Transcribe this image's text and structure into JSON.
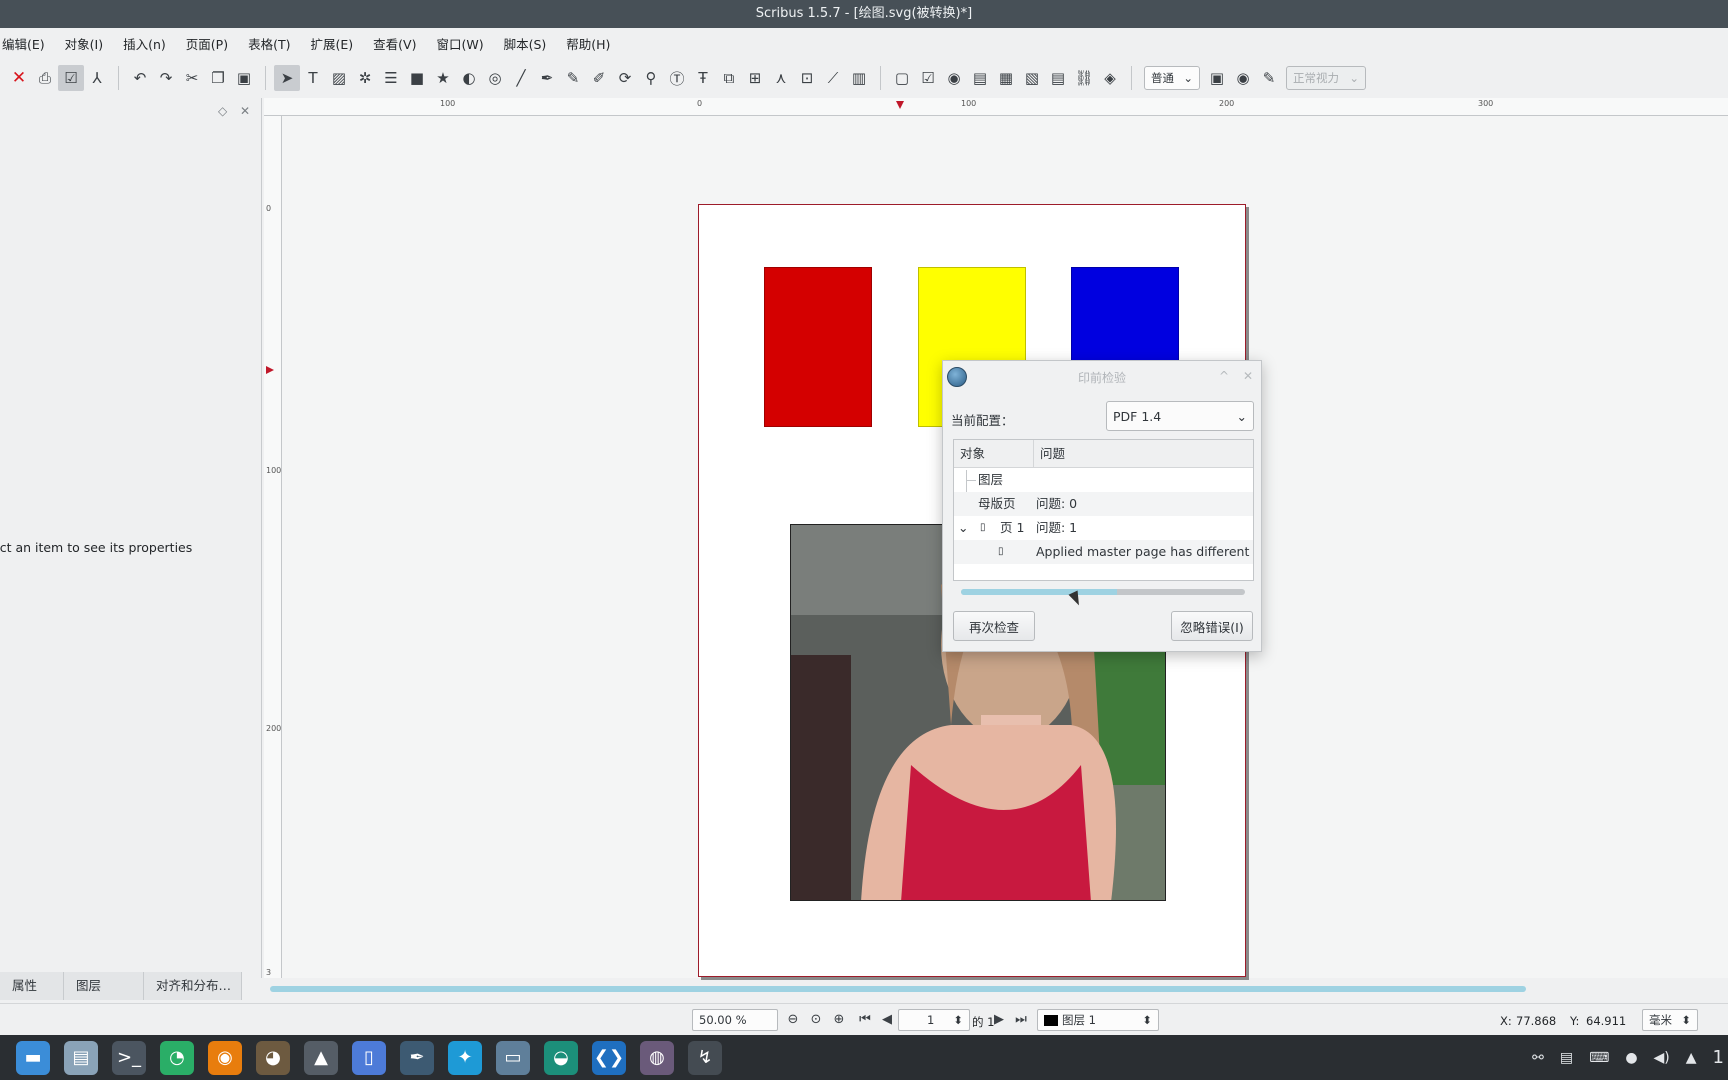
{
  "window": {
    "title": "Scribus 1.5.7 - [绘图.svg(被转换)*]"
  },
  "menu": [
    "编辑(E)",
    "对象(I)",
    "插入(n)",
    "页面(P)",
    "表格(T)",
    "扩展(E)",
    "查看(V)",
    "窗口(W)",
    "脚本(S)",
    "帮助(H)"
  ],
  "toolbar": {
    "mode_select": "普通",
    "vision_select": "正常视力",
    "icons": [
      "close-icon",
      "print-icon",
      "preflight-icon",
      "pdf-icon",
      "undo-icon",
      "redo-icon",
      "cut-icon",
      "copy-icon",
      "paste-icon",
      "select-icon",
      "text-frame-icon",
      "image-frame-icon",
      "render-frame-icon",
      "table-icon",
      "shape-icon",
      "polygon-icon",
      "arc-icon",
      "spiral-icon",
      "line-icon",
      "bezier-icon",
      "freehand-icon",
      "calligraphy-icon",
      "rotate-icon",
      "zoom-icon",
      "edit-text-icon",
      "story-editor-icon",
      "link-frames-icon",
      "unlink-frames-icon",
      "measure-icon",
      "copy-properties-icon",
      "eyedropper-icon",
      "barcode-icon",
      "pdf-button-icon",
      "pdf-checkbox-icon",
      "pdf-radio-icon",
      "pdf-textfield-icon",
      "pdf-combobox-icon",
      "pdf-listbox-icon",
      "pdf-annotation-icon",
      "pdf-link-icon",
      "pdf-3d-icon"
    ]
  },
  "left_panel": {
    "message": "ect an item to see its properties",
    "tabs": [
      "属性",
      "图层",
      "对齐和分布…"
    ]
  },
  "ruler": {
    "labels": [
      "100",
      "0",
      "100",
      "200",
      "300"
    ],
    "v_labels": [
      "0",
      "100",
      "200",
      "3"
    ]
  },
  "page": {
    "rect_colors": [
      "#d40000",
      "#ffff00",
      "#0000e0"
    ]
  },
  "dialog": {
    "title": "印前检验",
    "profile_label": "当前配置：",
    "profile_value": "PDF 1.4",
    "columns": [
      "对象",
      "问题"
    ],
    "rows": [
      {
        "object": "图层",
        "issue": ""
      },
      {
        "object": "母版页",
        "issue": "问题: 0"
      },
      {
        "object": "页 1",
        "issue": "问题: 1"
      },
      {
        "object": "",
        "issue": "Applied master page has different pa"
      }
    ],
    "progress": 0.55,
    "recheck_button": "再次检查",
    "ignore_button": "忽略错误(I)"
  },
  "status": {
    "zoom": "50.00 %",
    "page_number": "1",
    "page_of": "的 1",
    "layer": "图层 1",
    "x_label": "X:",
    "x_value": "77.868",
    "y_label": "Y:",
    "y_value": "64.911",
    "unit": "毫米"
  },
  "taskbar": {
    "apps": [
      "files-icon",
      "document-viewer-icon",
      "terminal-icon",
      "wechat-icon",
      "blender-icon",
      "gimp-icon",
      "inkscape-icon",
      "document-icon",
      "scribus-icon",
      "app-store-icon",
      "screenshot-icon",
      "edge-dev-icon",
      "vscode-icon",
      "color-picker-icon",
      "cursor-app-icon"
    ],
    "tray_icons": [
      "network-icon",
      "clipboard-icon",
      "keyboard-icon",
      "microphone-icon",
      "volume-icon",
      "tray-up-icon"
    ],
    "tray_text": "1"
  }
}
